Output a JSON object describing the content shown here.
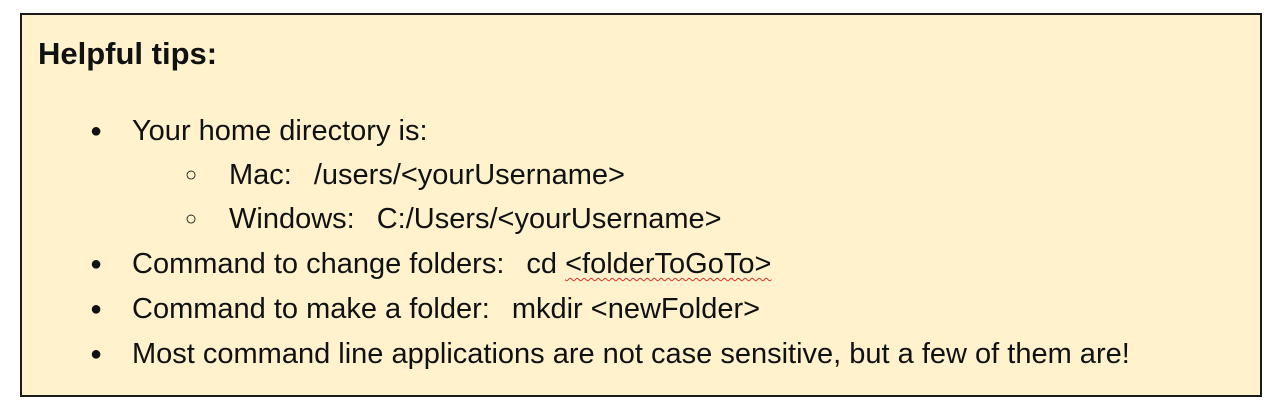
{
  "tips": {
    "title": "Helpful tips:",
    "home_label": "Your home directory is:",
    "home_mac_label": "Mac:",
    "home_mac_path": "/users/<yourUsername>",
    "home_windows_label": "Windows:",
    "home_windows_path": "C:/Users/<yourUsername>",
    "cd_label": "Command to change folders:",
    "cd_command": "cd",
    "cd_arg": "<folderToGoTo>",
    "mkdir_label": "Command to make a folder:",
    "mkdir_command": "mkdir <newFolder>",
    "case_note": "Most command line applications are not case sensitive, but a few of them are!",
    "bullet_filled": "●",
    "bullet_hollow": "○"
  },
  "colors": {
    "box_background": "#fff2cc",
    "box_border": "#1a1a1a",
    "spellcheck_underline": "#d93025"
  }
}
